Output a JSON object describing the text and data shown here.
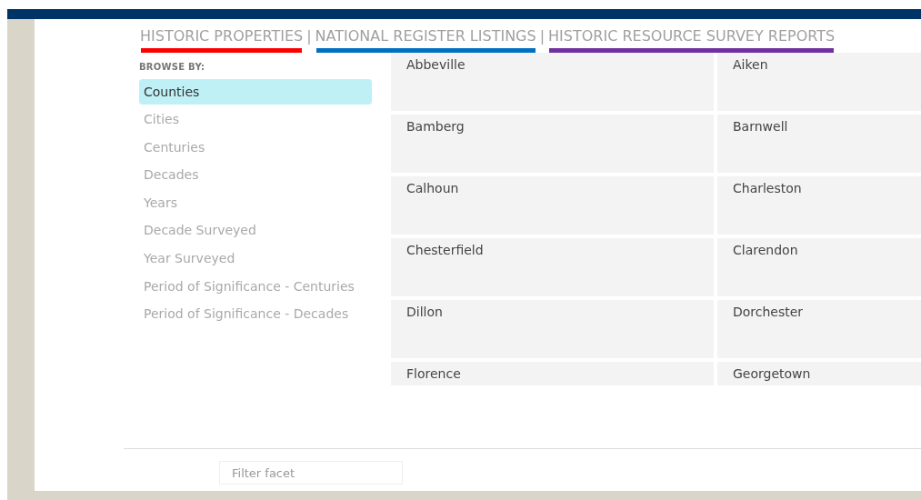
{
  "nav_tabs": [
    {
      "label": "HISTORIC PROPERTIES",
      "separator": "|",
      "color": "#ff0000"
    },
    {
      "label": "NATIONAL REGISTER LISTINGS",
      "separator": "|",
      "color": "#0070c0"
    },
    {
      "label": "HISTORIC RESOURCE SURVEY REPORTS",
      "color": "#7030a0"
    }
  ],
  "browse": {
    "heading": "BROWSE BY:",
    "items": [
      {
        "label": "Counties",
        "selected": true
      },
      {
        "label": "Cities",
        "selected": false
      },
      {
        "label": "Centuries",
        "selected": false
      },
      {
        "label": "Decades",
        "selected": false
      },
      {
        "label": "Years",
        "selected": false
      },
      {
        "label": "Decade Surveyed",
        "selected": false
      },
      {
        "label": "Year Surveyed",
        "selected": false
      },
      {
        "label": "Period of Significance - Centuries",
        "selected": false
      },
      {
        "label": "Period of Significance - Decades",
        "selected": false
      }
    ]
  },
  "results": [
    "Abbeville",
    "Aiken",
    "Bamberg",
    "Barnwell",
    "Calhoun",
    "Charleston",
    "Chesterfield",
    "Clarendon",
    "Dillon",
    "Dorchester",
    "Florence",
    "Georgetown"
  ],
  "filter": {
    "placeholder": "Filter facet"
  }
}
